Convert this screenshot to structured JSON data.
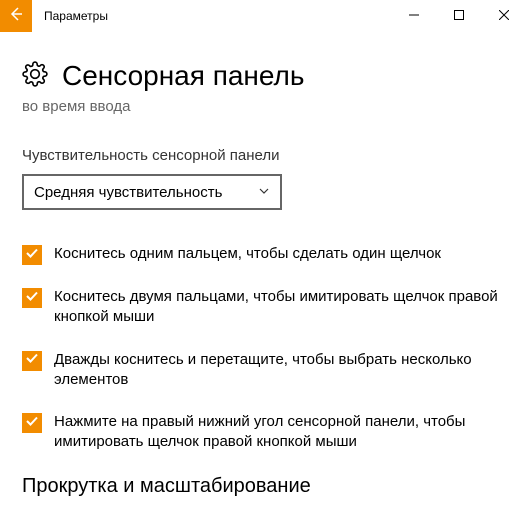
{
  "titlebar": {
    "app_title": "Параметры"
  },
  "page": {
    "title": "Сенсорная панель",
    "subtitle": "во время ввода"
  },
  "sensitivity": {
    "label": "Чувствительность сенсорной панели",
    "selected": "Средняя чувствительность"
  },
  "checkboxes": [
    {
      "label": "Коснитесь одним пальцем, чтобы сделать один щелчок",
      "checked": true
    },
    {
      "label": "Коснитесь двумя пальцами, чтобы имитировать щелчок правой кнопкой мыши",
      "checked": true
    },
    {
      "label": "Дважды коснитесь и перетащите, чтобы выбрать несколько элементов",
      "checked": true
    },
    {
      "label": "Нажмите на правый нижний угол сенсорной панели, чтобы имитировать щелчок правой кнопкой мыши",
      "checked": true
    }
  ],
  "section2": {
    "heading": "Прокрутка и масштабирование"
  },
  "colors": {
    "accent": "#F28C00"
  }
}
